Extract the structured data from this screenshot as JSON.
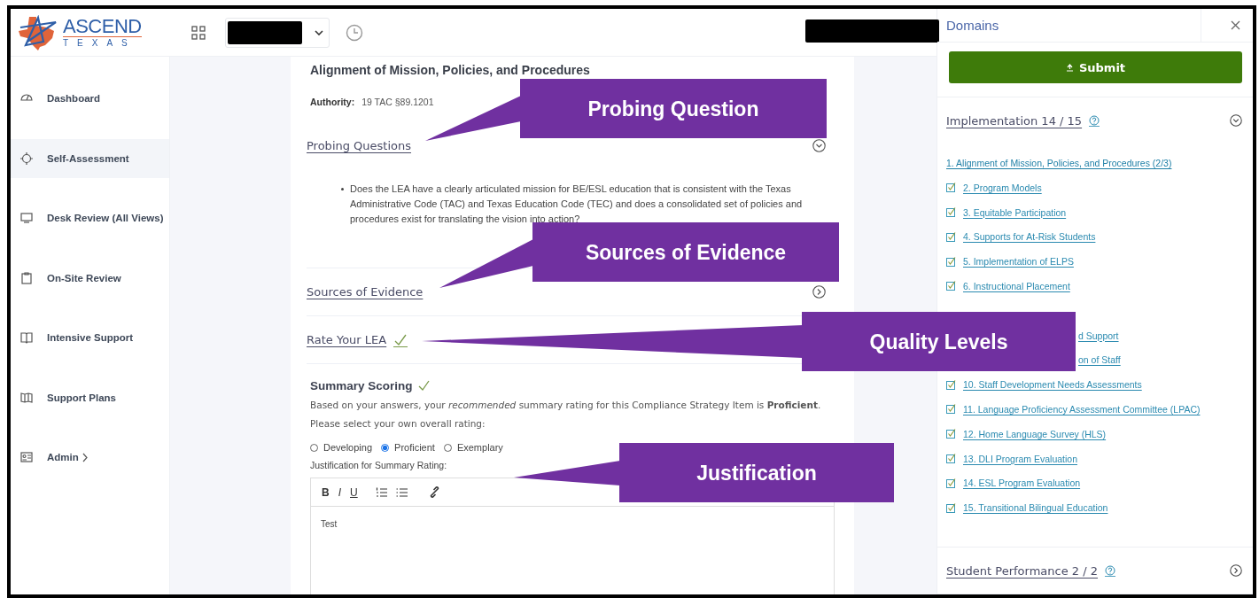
{
  "header": {
    "logo": {
      "name": "ASCEND",
      "tagline": "TEXAS"
    }
  },
  "sidebar": {
    "items": [
      {
        "label": "Dashboard",
        "selected": false
      },
      {
        "label": "Self-Assessment",
        "selected": true
      },
      {
        "label": "Desk Review (All Views)",
        "selected": false
      },
      {
        "label": "On-Site Review",
        "selected": false
      },
      {
        "label": "Intensive Support",
        "selected": false
      },
      {
        "label": "Support Plans",
        "selected": false
      },
      {
        "label": "Admin",
        "selected": false,
        "submenu": true
      }
    ]
  },
  "content": {
    "title": "Alignment of Mission, Policies, and Procedures",
    "authority_label": "Authority:",
    "authority_value": "19 TAC §89.1201",
    "sections": [
      {
        "title": "Probing Questions",
        "expanded": true,
        "bullets": [
          "Does the LEA have a clearly articulated mission for BE/ESL education that is consistent with the Texas Administrative Code (TAC) and Texas Education Code (TEC) and does a consolidated set of policies and procedures exist for translating the vision into action?"
        ]
      },
      {
        "title": "Sources of Evidence",
        "expanded": false
      },
      {
        "title": "Rate Your LEA",
        "complete": true
      }
    ],
    "summary": {
      "title": "Summary Scoring",
      "complete": true,
      "text": "Based on your answers, your *recommended* summary rating for this Compliance Strategy Item is **Proficient**. Please select your own overall rating:",
      "options": [
        {
          "label": "Developing",
          "selected": false
        },
        {
          "label": "Proficient",
          "selected": true
        },
        {
          "label": "Exemplary",
          "selected": false
        }
      ],
      "justification_label": "Justification for Summary Rating:",
      "toolbar": [
        "B",
        "I",
        "U"
      ],
      "value": "Test"
    }
  },
  "panel": {
    "title": "Domains",
    "submit": "Submit",
    "domains": [
      {
        "title": "Implementation 14 / 15",
        "expanded": true,
        "items": [
          {
            "kind": "link",
            "label": "1. Alignment of Mission, Policies, and Procedures (2/3)",
            "done": false
          },
          {
            "kind": "link",
            "label": "2. Program Models",
            "done": true
          },
          {
            "kind": "link",
            "label": "3. Equitable Participation",
            "done": true
          },
          {
            "kind": "link",
            "label": "4. Supports for At-Risk Students",
            "done": true
          },
          {
            "kind": "link",
            "label": "5. Implementation of ELPS",
            "done": true
          },
          {
            "kind": "link",
            "label": "6. Instructional Placement",
            "done": true
          },
          {
            "kind": "covered"
          },
          {
            "kind": "clipped",
            "label": "d Support"
          },
          {
            "kind": "clipped",
            "label": "on of Staff"
          },
          {
            "kind": "link",
            "label": "10. Staff Development Needs Assessments",
            "done": true
          },
          {
            "kind": "link",
            "label": "11. Language Proficiency Assessment Committee (LPAC)",
            "done": true
          },
          {
            "kind": "link",
            "label": "12. Home Language Survey (HLS)",
            "done": true
          },
          {
            "kind": "link",
            "label": "13. DLI Program Evaluation",
            "done": true
          },
          {
            "kind": "link",
            "label": "14. ESL Program Evaluation",
            "done": true
          },
          {
            "kind": "link",
            "label": "15. Transitional Bilingual Education",
            "done": true
          }
        ]
      },
      {
        "title": "Student Performance 2 / 2",
        "expanded": false
      }
    ]
  },
  "callouts": [
    {
      "text": "Probing Question"
    },
    {
      "text": "Sources of Evidence"
    },
    {
      "text": "Quality Levels"
    },
    {
      "text": "Justification"
    }
  ]
}
